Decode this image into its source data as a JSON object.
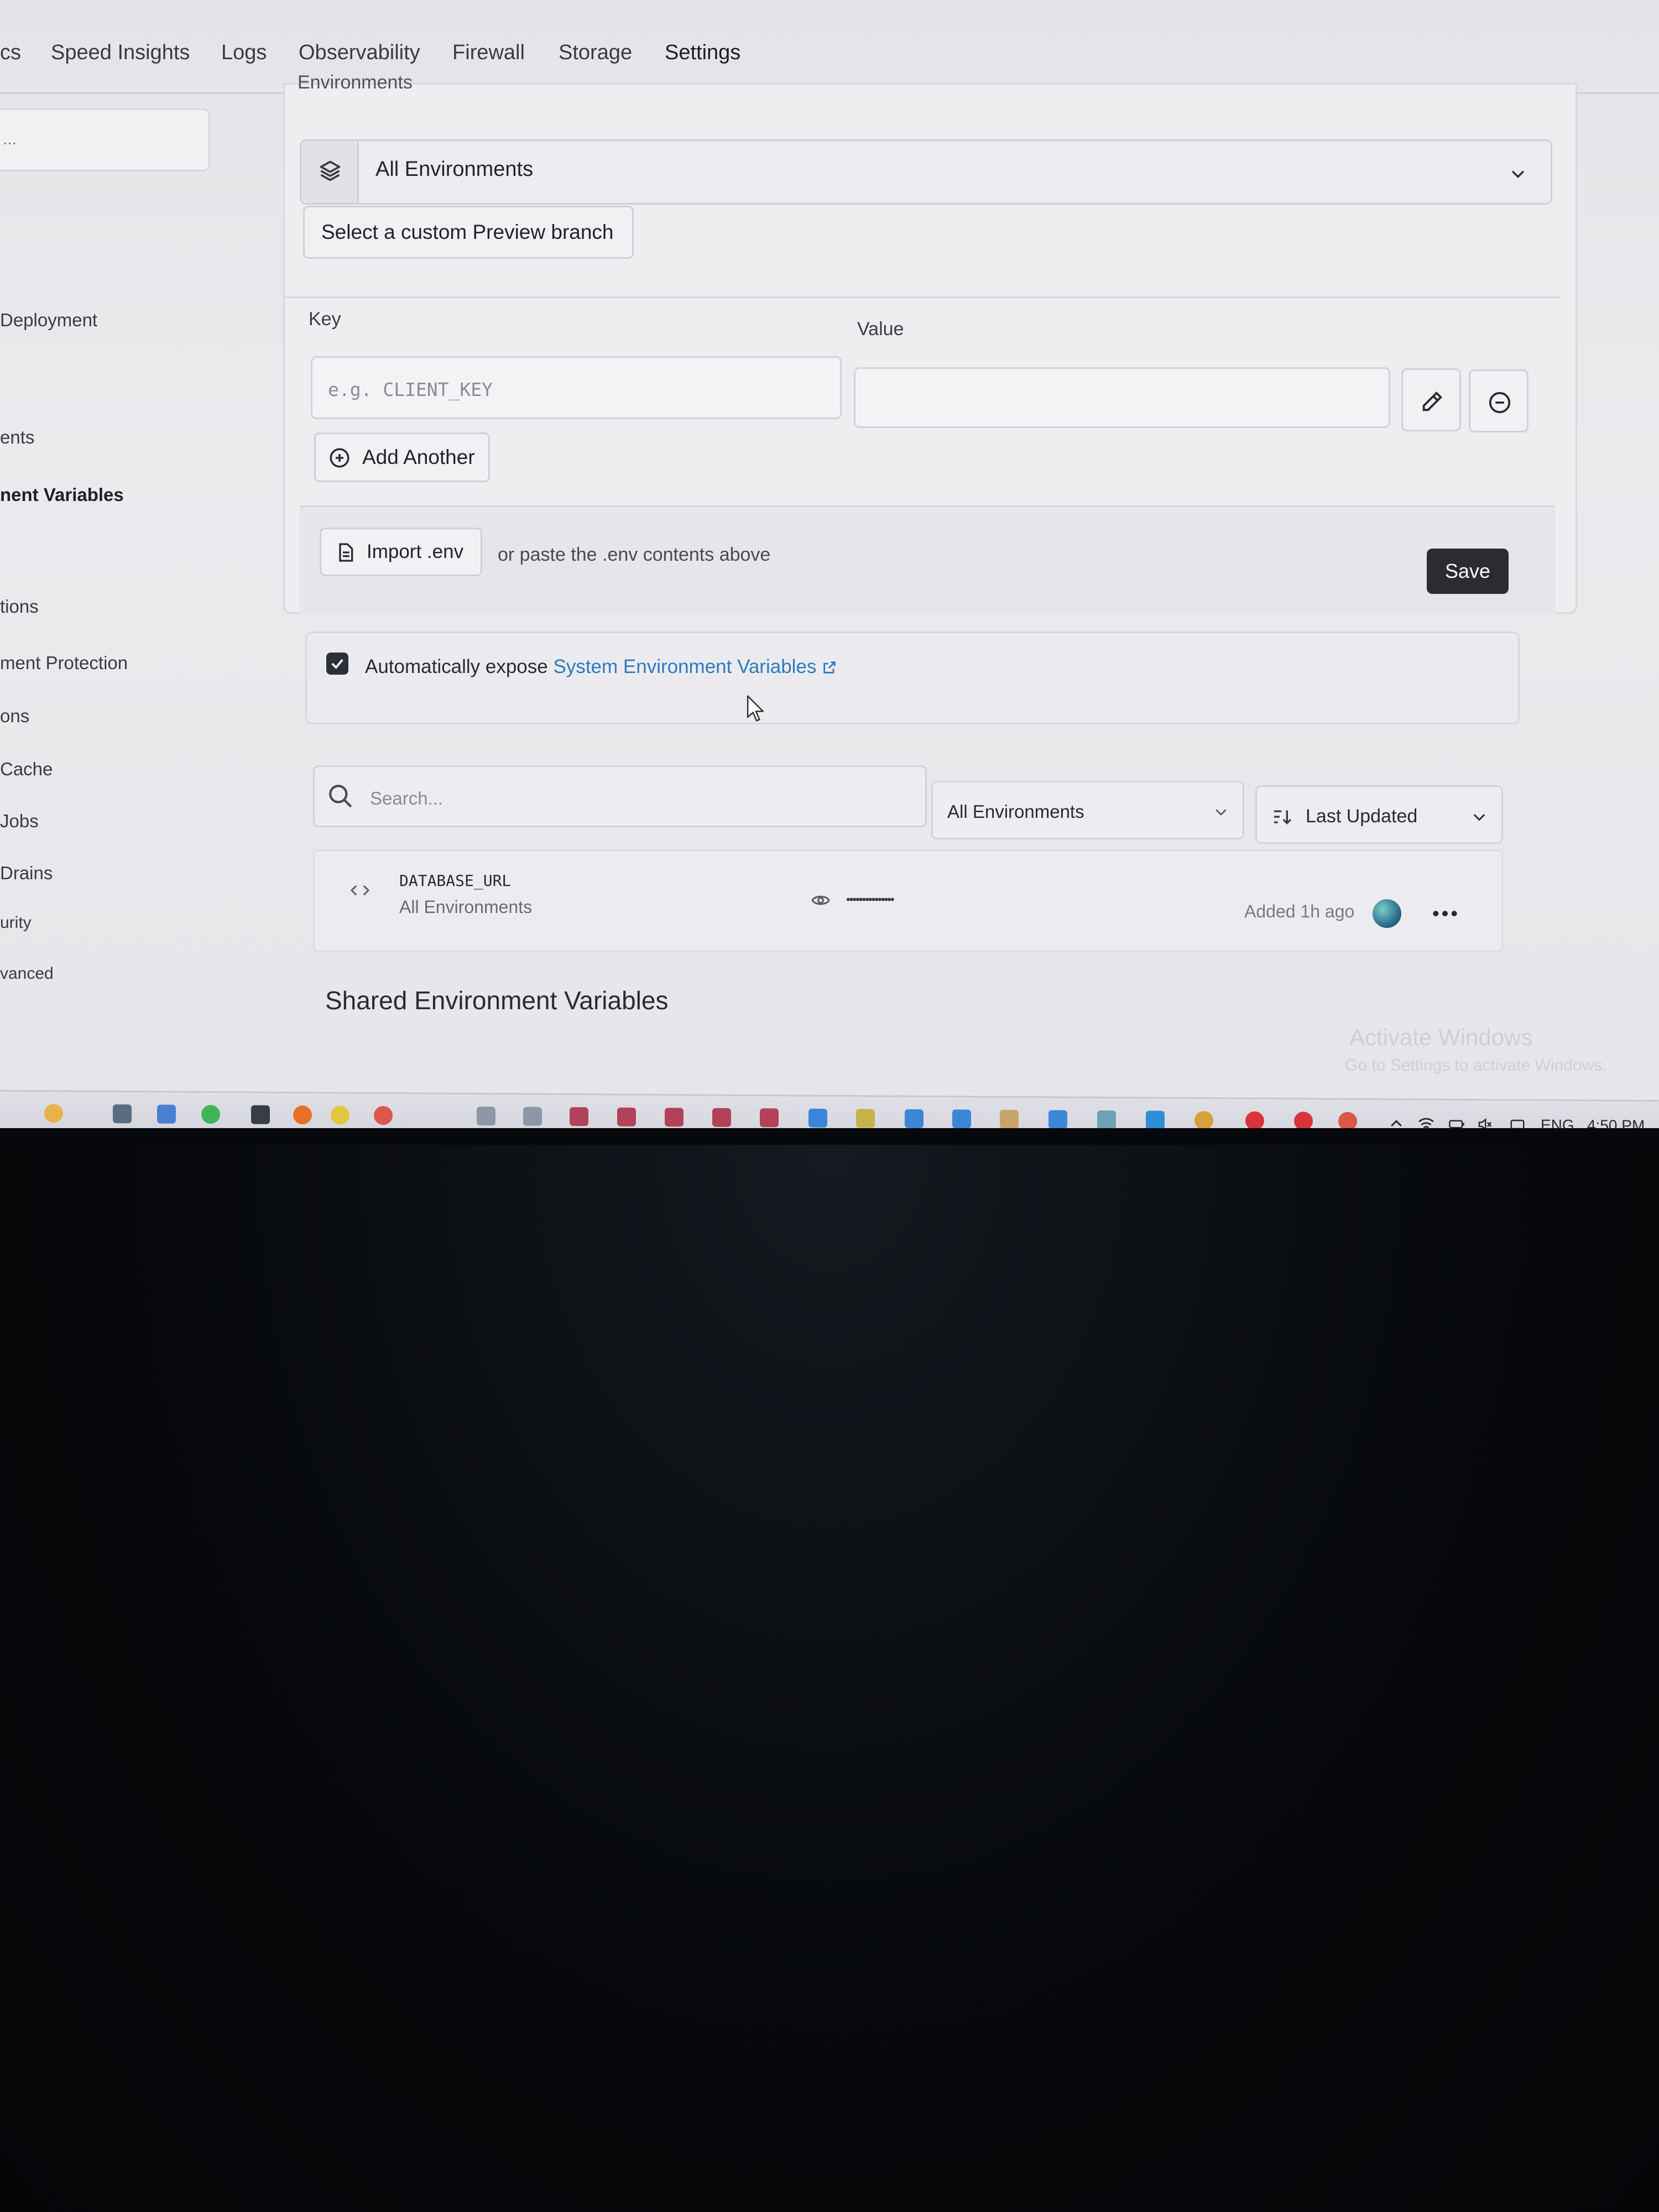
{
  "nav": {
    "tabs": [
      {
        "label": "cs"
      },
      {
        "label": "Speed Insights"
      },
      {
        "label": "Logs"
      },
      {
        "label": "Observability"
      },
      {
        "label": "Firewall"
      },
      {
        "label": "Storage"
      },
      {
        "label": "Settings",
        "active": true
      }
    ]
  },
  "sidebar": {
    "search_placeholder": "...",
    "items": [
      {
        "label": "Deployment"
      },
      {
        "label": "ents"
      },
      {
        "label": "nent Variables",
        "active": true
      },
      {
        "label": "tions"
      },
      {
        "label": "ment Protection"
      },
      {
        "label": "ons"
      },
      {
        "label": "Cache"
      },
      {
        "label": "Jobs"
      },
      {
        "label": "Drains"
      },
      {
        "label": "urity"
      },
      {
        "label": "vanced"
      }
    ]
  },
  "form": {
    "environments_label": "Environments",
    "environment_select": "All Environments",
    "preview_branch_button": "Select a custom Preview branch",
    "key_label": "Key",
    "value_label": "Value",
    "key_placeholder": "e.g. CLIENT_KEY",
    "value_value": "",
    "add_another": "Add Another",
    "import_button": "Import .env",
    "paste_hint": "or paste the .env contents above",
    "save": "Save",
    "auto_expose_prefix": "Automatically expose",
    "auto_expose_link": "System Environment Variables",
    "auto_expose_checked": true
  },
  "list": {
    "search_placeholder": "Search...",
    "env_filter": "All Environments",
    "sort": "Last Updated",
    "rows": [
      {
        "name": "DATABASE_URL",
        "environments": "All Environments",
        "masked_value": "•••••••••••••••",
        "added": "Added 1h ago"
      }
    ]
  },
  "shared": {
    "title": "Shared Environment Variables"
  },
  "watermark": {
    "line1": "Activate Windows",
    "line2": "Go to Settings to activate Windows."
  },
  "taskbar": {
    "language": "ENG",
    "time": "4:50 PM"
  },
  "colors": {
    "accent_link": "#2f79c0",
    "save_button": "#2b2b30",
    "checkbox": "#2d2f38"
  }
}
